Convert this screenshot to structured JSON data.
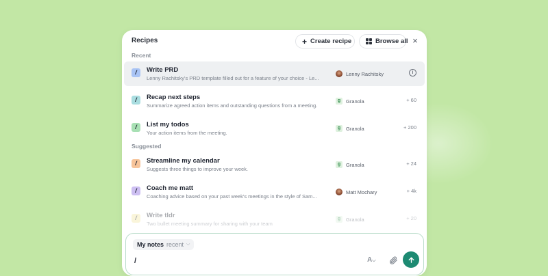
{
  "panel": {
    "title": "Recipes",
    "create_label": "Create recipe",
    "browse_label": "Browse all"
  },
  "sections": {
    "recent": "Recent",
    "suggested": "Suggested"
  },
  "recent": [
    {
      "title": "Write PRD",
      "desc": "Lenny Rachitsky's PRD template filled out for a feature of your choice - Le...",
      "author": "Lenny Rachitsky",
      "author_icon": "avatar",
      "count": "",
      "icon_color": "#a9c4f5"
    },
    {
      "title": "Recap next steps",
      "desc": "Summarize agreed action items and outstanding questions from a meeting.",
      "author": "Granola",
      "author_icon": "granola-icon",
      "count": "+ 60",
      "icon_color": "#a9dde0"
    },
    {
      "title": "List my todos",
      "desc": "Your action items from the meeting.",
      "author": "Granola",
      "author_icon": "granola-icon",
      "count": "+ 200",
      "icon_color": "#a8e0b4"
    }
  ],
  "suggested": [
    {
      "title": "Streamline my calendar",
      "desc": "Suggests three things to improve your week.",
      "author": "Granola",
      "author_icon": "granola-icon",
      "count": "+ 24",
      "icon_color": "#f7c49a"
    },
    {
      "title": "Coach me matt",
      "desc": "Coaching advice based on your past week's meetings in the style of Sam...",
      "author": "Matt Mochary",
      "author_icon": "avatar",
      "count": "+ 4k",
      "icon_color": "#cdbff2"
    },
    {
      "title": "Write tldr",
      "desc": "Two bullet meeting summary for sharing with your team",
      "author": "Granola",
      "author_icon": "granola-icon",
      "count": "+ 20",
      "icon_color": "#f3e7a0"
    }
  ],
  "composer": {
    "notes_label": "My notes",
    "notes_filter": "recent",
    "input_value": "/",
    "font_icon_text": "A",
    "send_color": "#1d8a72"
  },
  "icons": {
    "recipe": "/",
    "close": "×",
    "plus": "+",
    "granola": "g",
    "info": "i"
  }
}
